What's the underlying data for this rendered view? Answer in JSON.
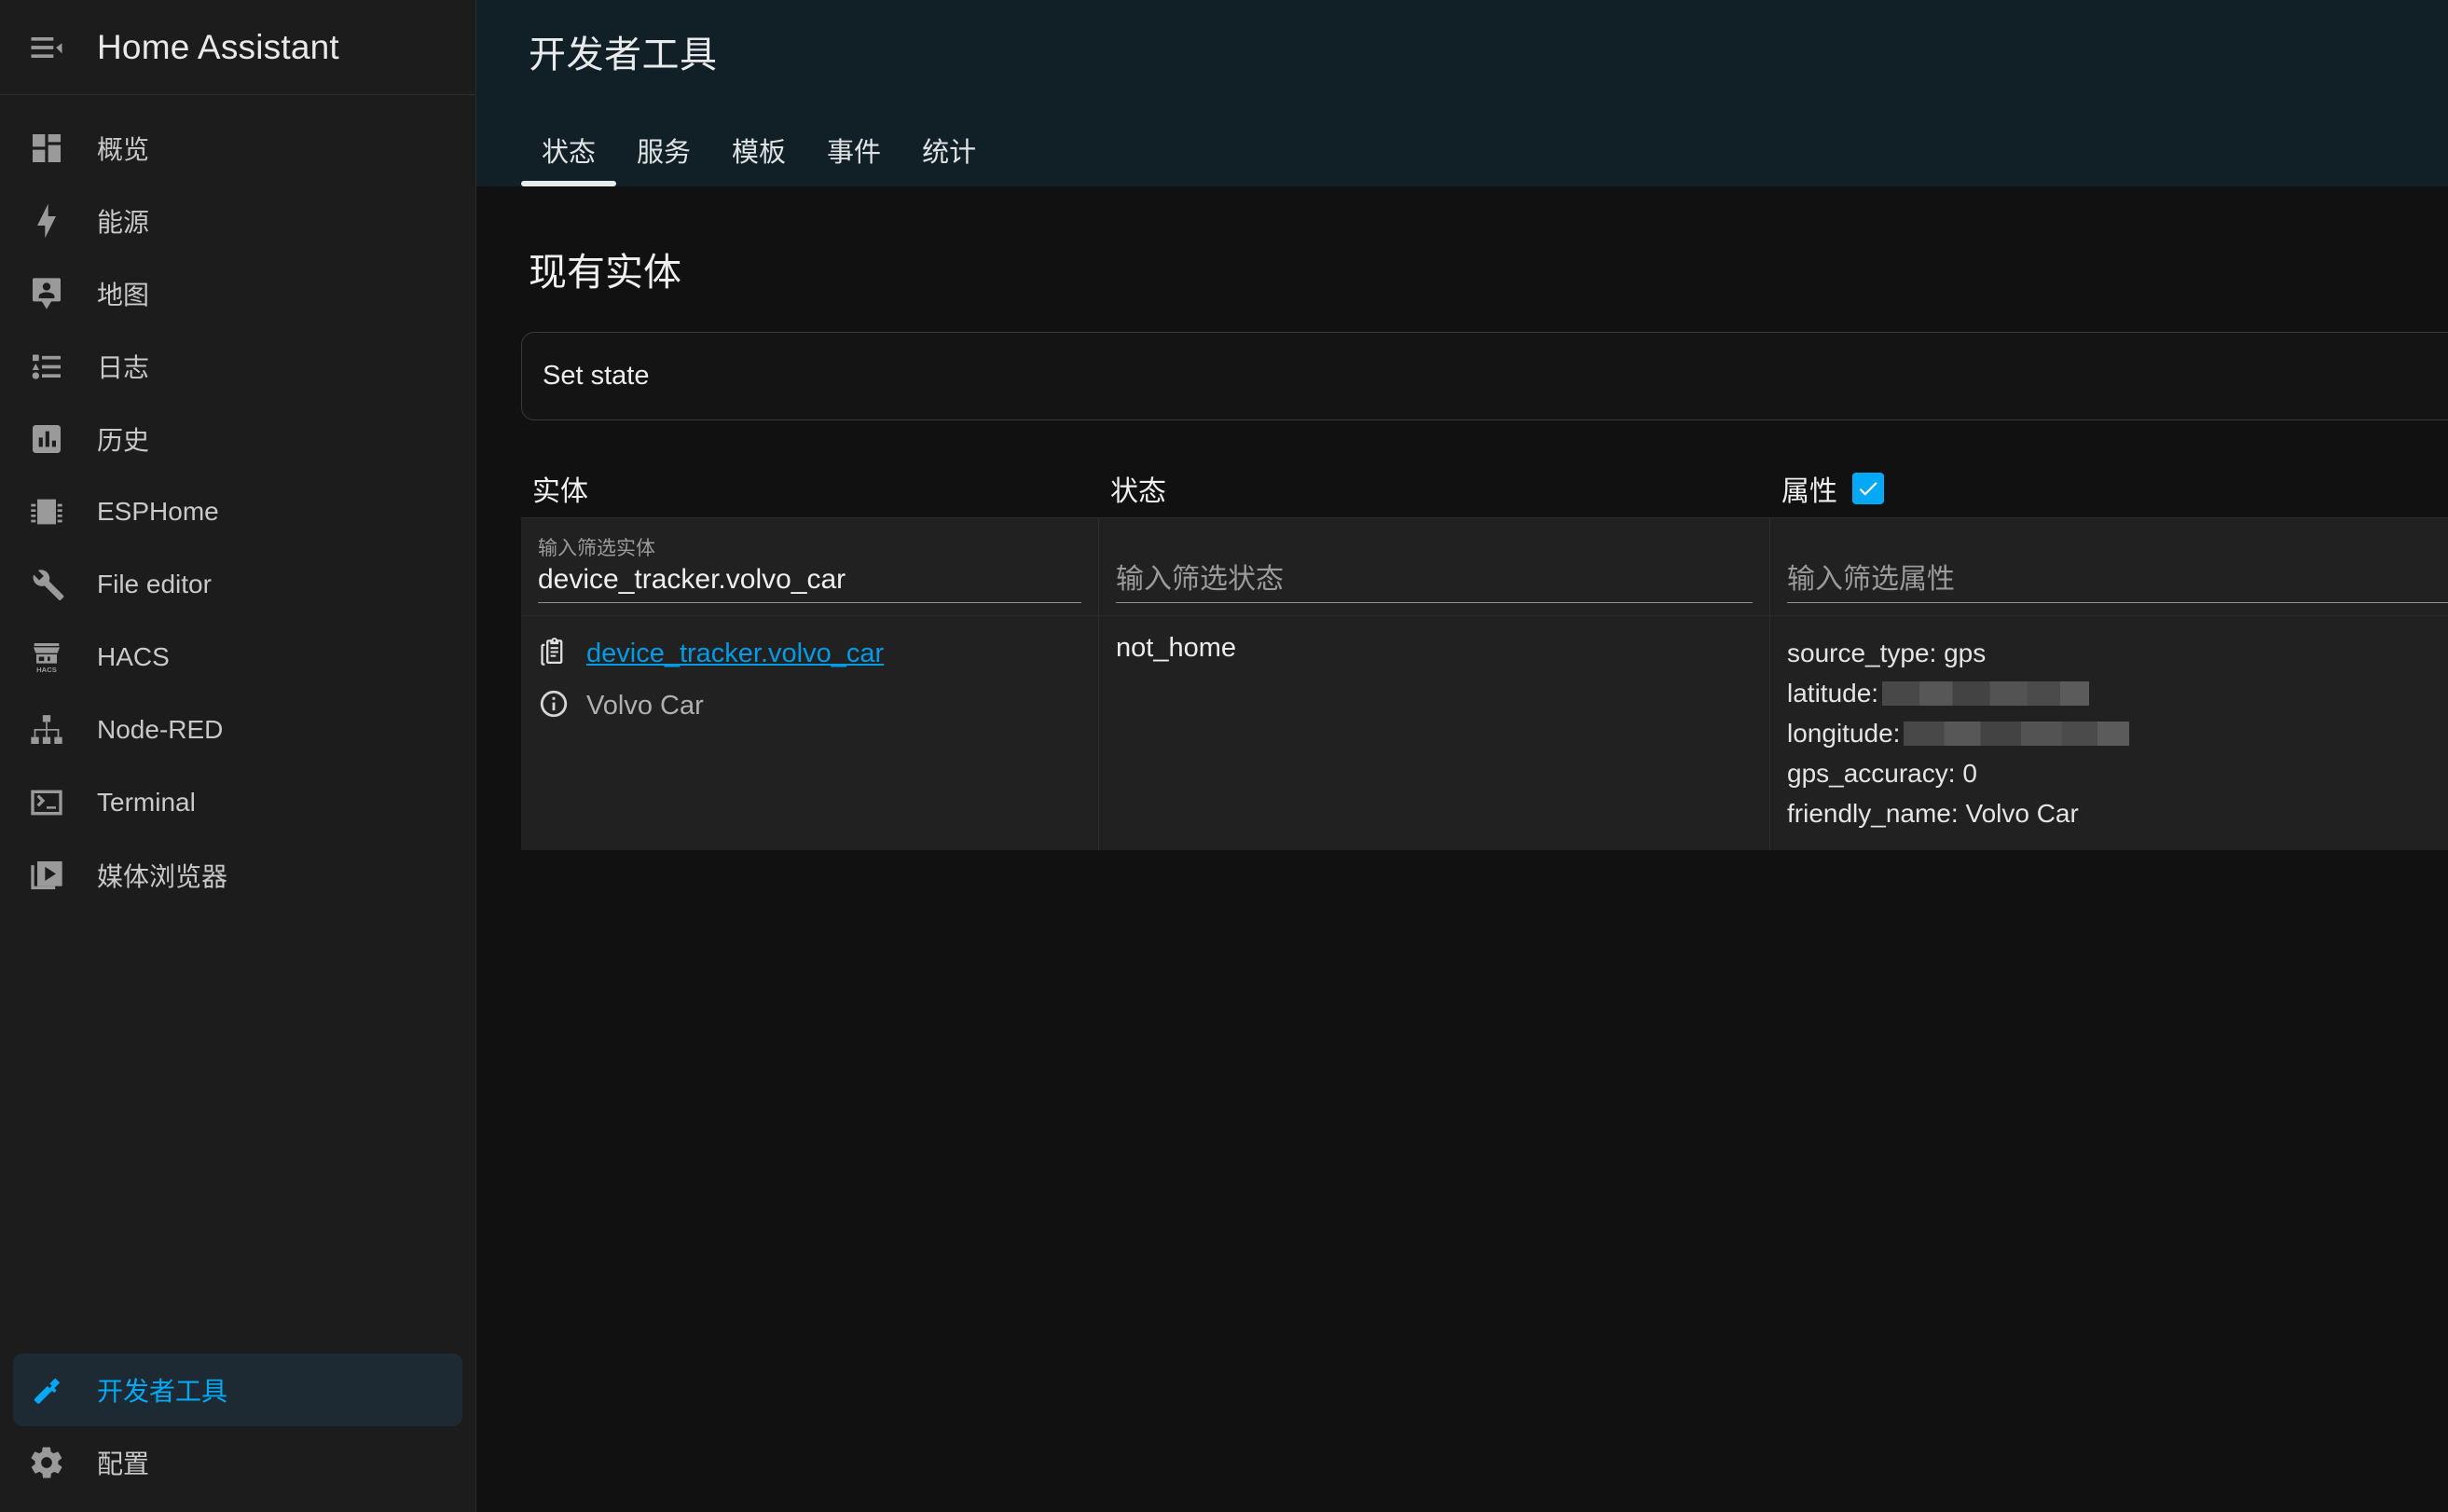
{
  "sidebar": {
    "menu_icon": "menu-open-icon",
    "title": "Home Assistant",
    "items": [
      {
        "label": "概览",
        "icon": "view-dashboard-icon",
        "active": false
      },
      {
        "label": "能源",
        "icon": "lightning-bolt-icon",
        "active": false
      },
      {
        "label": "地图",
        "icon": "map-marker-account-icon",
        "active": false
      },
      {
        "label": "日志",
        "icon": "format-list-bulleted-type-icon",
        "active": false
      },
      {
        "label": "历史",
        "icon": "chart-box-icon",
        "active": false
      },
      {
        "label": "ESPHome",
        "icon": "chip-icon",
        "active": false
      },
      {
        "label": "File editor",
        "icon": "wrench-icon",
        "active": false
      },
      {
        "label": "HACS",
        "icon": "hacs-store-icon",
        "active": false
      },
      {
        "label": "Node-RED",
        "icon": "sitemap-icon",
        "active": false
      },
      {
        "label": "Terminal",
        "icon": "console-icon",
        "active": false
      },
      {
        "label": "媒体浏览器",
        "icon": "play-box-multiple-icon",
        "active": false
      }
    ],
    "bottom_items": [
      {
        "label": "开发者工具",
        "icon": "hammer-icon",
        "active": true
      },
      {
        "label": "配置",
        "icon": "cog-icon",
        "active": false
      }
    ],
    "accent_color": "#03a9f4",
    "active_background": "#1e2a33"
  },
  "header": {
    "title": "开发者工具",
    "background": "#111f26",
    "tabs": [
      {
        "label": "状态",
        "active": true
      },
      {
        "label": "服务",
        "active": false
      },
      {
        "label": "模板",
        "active": false
      },
      {
        "label": "事件",
        "active": false
      },
      {
        "label": "统计",
        "active": false
      }
    ]
  },
  "main": {
    "section_title": "现有实体",
    "set_state_label": "Set state",
    "table": {
      "columns": [
        {
          "key": "entity",
          "label": "实体"
        },
        {
          "key": "state",
          "label": "状态"
        },
        {
          "key": "attributes",
          "label": "属性"
        }
      ],
      "attributes_checkbox_checked": true,
      "checkbox_color": "#03a9f4",
      "filters": {
        "entity": {
          "label": "输入筛选实体",
          "value": "device_tracker.volvo_car",
          "placeholder": "输入筛选实体"
        },
        "state": {
          "label": "输入筛选状态",
          "value": "",
          "placeholder": "输入筛选状态"
        },
        "attributes": {
          "label": "输入筛选属性",
          "value": "",
          "placeholder": "输入筛选属性"
        }
      },
      "rows": [
        {
          "entity_id": "device_tracker.volvo_car",
          "friendly_name": "Volvo Car",
          "copy_icon": "clipboard-text-icon",
          "info_icon": "information-outline-icon",
          "state": "not_home",
          "attributes": [
            {
              "key": "source_type",
              "value": "gps",
              "redacted": false
            },
            {
              "key": "latitude",
              "value": "",
              "redacted": true
            },
            {
              "key": "longitude",
              "value": "",
              "redacted": true
            },
            {
              "key": "gps_accuracy",
              "value": "0",
              "redacted": false
            },
            {
              "key": "friendly_name",
              "value": "Volvo Car",
              "redacted": false
            }
          ]
        }
      ]
    }
  }
}
